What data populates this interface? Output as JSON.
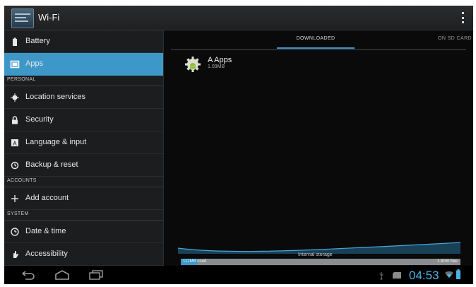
{
  "action_bar": {
    "title": "Wi-Fi",
    "icon": "settings-app-icon",
    "menu_icon": "overflow-menu-icon"
  },
  "sidebar": {
    "items": [
      {
        "label": "Battery",
        "icon": "battery-icon"
      },
      {
        "label": "Apps",
        "icon": "apps-icon",
        "selected": true
      },
      {
        "label": "Location services",
        "icon": "location-icon"
      },
      {
        "label": "Security",
        "icon": "lock-icon"
      },
      {
        "label": "Language & input",
        "icon": "keyboard-icon"
      },
      {
        "label": "Backup & reset",
        "icon": "backup-icon"
      },
      {
        "label": "Add account",
        "icon": "plus-icon"
      },
      {
        "label": "Date & time",
        "icon": "clock-icon"
      },
      {
        "label": "Accessibility",
        "icon": "hand-icon"
      }
    ],
    "sections": [
      "PERSONAL",
      "ACCOUNTS",
      "SYSTEM"
    ]
  },
  "tabs": [
    {
      "label": "DOWNLOADED",
      "active": true
    },
    {
      "label": "ON SD CARD",
      "active": false
    }
  ],
  "apps": [
    {
      "name": "A Apps",
      "size": "1.09MB",
      "icon": "android-app-icon"
    }
  ],
  "storage": {
    "caption": "Internal storage",
    "used_label": "112MB used",
    "free_label": "1.9GB free",
    "used_fraction": 0.06
  },
  "navbar": {
    "buttons": [
      "back-icon",
      "home-icon",
      "recent-apps-icon"
    ],
    "time": "04:53",
    "status_icons": [
      "usb-icon",
      "sd-card-icon",
      "wifi-icon",
      "battery-status-icon"
    ]
  },
  "colors": {
    "accent": "#3d98c9",
    "clock": "#4cb3e6",
    "background": "#0e0e0f"
  }
}
